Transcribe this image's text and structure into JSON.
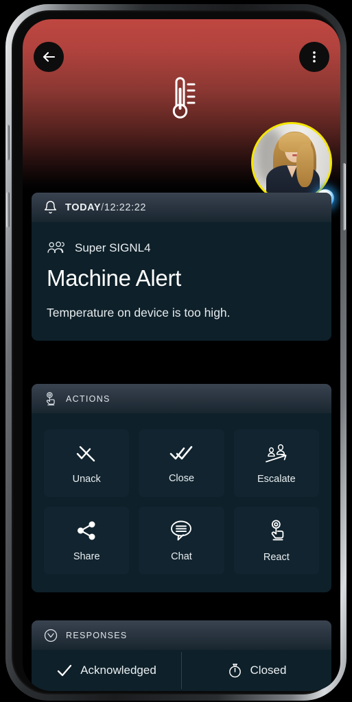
{
  "header": {
    "back_icon": "arrow-left-icon",
    "menu_icon": "more-vertical-icon",
    "hero_icon": "thermometer-icon",
    "avatar_name": "avatar",
    "status_icon": "online-status-dot"
  },
  "alert": {
    "bell_icon": "bell-icon",
    "day_label": "TODAY",
    "separator": "/",
    "time": "12:22:22",
    "group_icon": "group-users-icon",
    "group_name": "Super SIGNL4",
    "title": "Machine Alert",
    "message": "Temperature on device is too high."
  },
  "actions": {
    "header_icon": "tap-hand-icon",
    "header_label": "ACTIONS",
    "items": [
      {
        "label": "Unack",
        "icon": "check-slash-icon"
      },
      {
        "label": "Close",
        "icon": "double-check-icon"
      },
      {
        "label": "Escalate",
        "icon": "escalate-users-arrow-icon"
      },
      {
        "label": "Share",
        "icon": "share-nodes-icon"
      },
      {
        "label": "Chat",
        "icon": "chat-bubble-icon"
      },
      {
        "label": "React",
        "icon": "tap-hand-icon"
      }
    ]
  },
  "responses": {
    "header_icon": "clock-icon",
    "header_label": "RESPONSES",
    "tabs": [
      {
        "label": "Acknowledged",
        "icon": "check-icon"
      },
      {
        "label": "Closed",
        "icon": "stopwatch-icon"
      }
    ]
  },
  "colors": {
    "hero_red": "#bf4741",
    "card_bg": "#0e2029",
    "tile_bg": "#11242f",
    "card_header_top": "#3a4450",
    "avatar_ring": "#f5e600",
    "status_dot": "#1c8fe0",
    "text_primary": "#ffffff"
  },
  "device": {
    "frame": "smartphone-frame",
    "buttons": [
      "volume-up",
      "volume-down",
      "power"
    ]
  }
}
